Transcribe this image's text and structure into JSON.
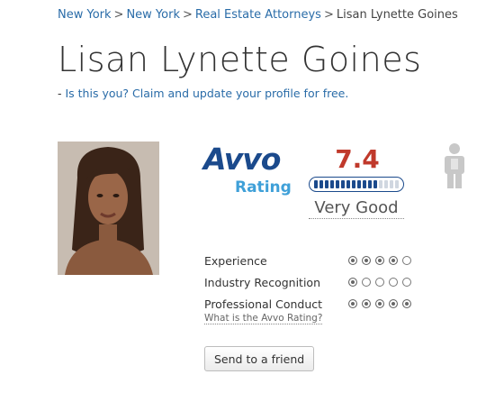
{
  "breadcrumb": {
    "items": [
      "New York",
      "New York",
      "Real Estate Attorneys"
    ],
    "current": "Lisan Lynette Goines",
    "separator": ">"
  },
  "profile": {
    "name": "Lisan Lynette Goines",
    "claim_prefix": "- ",
    "claim_link": "Is this you? Claim and update your profile for free."
  },
  "rating": {
    "logo_brand": "Avvo",
    "logo_sub": "Rating",
    "score": "7.4",
    "score_value": 7.4,
    "score_max": 10,
    "verdict": "Very Good"
  },
  "criteria": [
    {
      "label": "Experience",
      "filled": 4,
      "total": 5
    },
    {
      "label": "Industry Recognition",
      "filled": 1,
      "total": 5
    },
    {
      "label": "Professional Conduct",
      "filled": 5,
      "total": 5
    }
  ],
  "what_link": "What is the Avvo Rating?",
  "send_button": "Send to a friend",
  "colors": {
    "link": "#2a6ca8",
    "score": "#c0392b",
    "brand_dark": "#1b4a8c",
    "brand_light": "#3fa0d8"
  }
}
